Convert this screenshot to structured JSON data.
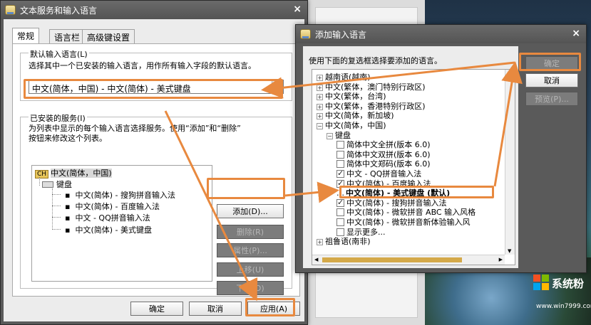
{
  "colors": {
    "accent_orange": "#e8893f",
    "titlebar": "#5a5a5a",
    "disabled_button": "#7c7c7c"
  },
  "main_dialog": {
    "title": "文本服务和输入语言",
    "tabs": [
      "常规",
      "语言栏",
      "高级键设置"
    ],
    "default_lang_label": "默认输入语言(L)",
    "default_lang_desc": "选择其中一个已安装的输入语言，用作所有输入字段的默认语言。",
    "default_lang_value": "中文(简体，中国) - 中文(简体) - 美式键盘",
    "installed_label": "已安装的服务(I)",
    "installed_desc_1": "为列表中显示的每个输入语言选择服务。使用“添加”和“删除”",
    "installed_desc_2": "按钮来修改这个列表。",
    "tree": {
      "lang_badge": "CH",
      "lang": "中文(简体，中国)",
      "group": "键盘",
      "items": [
        "中文(简体) - 搜狗拼音输入法",
        "中文(简体) - 百度输入法",
        "中文 - QQ拼音输入法",
        "中文(简体) - 美式键盘"
      ]
    },
    "buttons": {
      "add": "添加(D)...",
      "remove": "删除(R)",
      "properties": "属性(P)...",
      "move_up": "上移(U)",
      "move_down": "下移(O)",
      "ok": "确定",
      "cancel": "取消",
      "apply": "应用(A)"
    }
  },
  "add_dialog": {
    "title": "添加输入语言",
    "desc": "使用下面的复选框选择要添加的语言。",
    "buttons": {
      "ok": "确定",
      "cancel": "取消",
      "preview": "预览(P)..."
    },
    "tree": [
      {
        "label": "越南语(越南)",
        "level": 0,
        "type": "plus"
      },
      {
        "label": "中文(繁体，澳门特别行政区)",
        "level": 0,
        "type": "plus"
      },
      {
        "label": "中文(繁体，台湾)",
        "level": 0,
        "type": "plus"
      },
      {
        "label": "中文(繁体，香港特别行政区)",
        "level": 0,
        "type": "plus"
      },
      {
        "label": "中文(简体，新加坡)",
        "level": 0,
        "type": "plus"
      },
      {
        "label": "中文(简体，中国)",
        "level": 0,
        "type": "minus"
      },
      {
        "label": "键盘",
        "level": 1,
        "type": "minus"
      },
      {
        "label": "简体中文全拼(版本 6.0)",
        "level": 2,
        "type": "cb",
        "checked": false
      },
      {
        "label": "简体中文双拼(版本 6.0)",
        "level": 2,
        "type": "cb",
        "checked": false
      },
      {
        "label": "简体中文郑码(版本 6.0)",
        "level": 2,
        "type": "cb",
        "checked": false
      },
      {
        "label": "中文 - QQ拼音输入法",
        "level": 2,
        "type": "cb",
        "checked": true
      },
      {
        "label": "中文(简体) - 百度输入法",
        "level": 2,
        "type": "cb",
        "checked": true
      },
      {
        "label": "中文(简体) - 美式键盘 (默认)",
        "level": 2,
        "type": "bold"
      },
      {
        "label": "中文(简体) - 搜狗拼音输入法",
        "level": 2,
        "type": "cb",
        "checked": true
      },
      {
        "label": "中文(简体) - 微软拼音 ABC 输入风格",
        "level": 2,
        "type": "cb",
        "checked": false
      },
      {
        "label": "中文(简体) - 微软拼音新体验输入风",
        "level": 2,
        "type": "cb",
        "checked": false
      },
      {
        "label": "显示更多...",
        "level": 2,
        "type": "cb",
        "checked": false
      },
      {
        "label": "祖鲁语(南非)",
        "level": 0,
        "type": "plus"
      }
    ]
  },
  "watermark": {
    "brand": "系统粉",
    "url": "www.win7999.com"
  }
}
